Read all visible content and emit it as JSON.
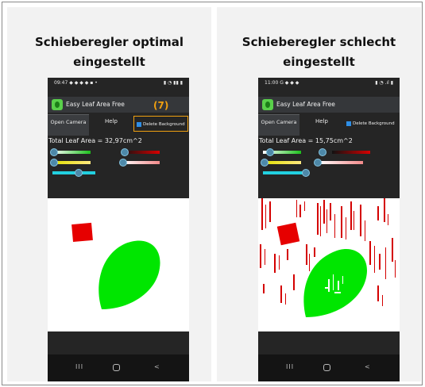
{
  "panels": [
    {
      "heading": "Schieberegler optimal eingestellt",
      "phone": {
        "status_time": "09:47 ◆ ◆ ◆ ◆ ▪ •",
        "status_icons": "▮ ◔ ▮▮ ▮",
        "app_title": "Easy Leaf Area Free",
        "badge": "(7)",
        "open_camera": "Open Camera",
        "help": "Help",
        "delete_background": "Delete Background",
        "leaf_area": "Total Leaf Area = 32,97cm^2"
      }
    },
    {
      "heading": "Schieberegler schlecht eingestellt",
      "phone": {
        "status_time": "11:00 G ◆ ◆ ◆",
        "status_icons": "▮ ◔ .ıl ▮",
        "app_title": "Easy Leaf Area Free",
        "open_camera": "Open Camera",
        "help": "Help",
        "delete_background": "Delete Background",
        "leaf_area": "Total Leaf Area = 15,75cm^2"
      }
    }
  ],
  "nav": {
    "recent": "III",
    "back": "<"
  },
  "colors": {
    "leaf_green": "#00e600",
    "reference_red": "#e60000",
    "badge_orange": "#f0a010",
    "slider_knob": "#4d88a8"
  }
}
